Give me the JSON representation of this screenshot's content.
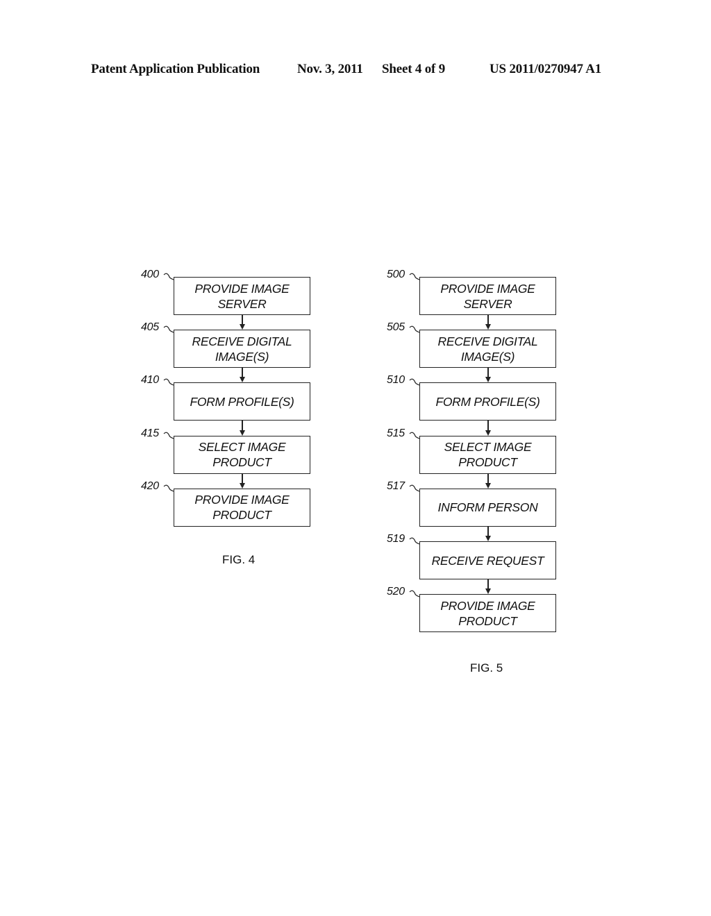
{
  "header": {
    "publication": "Patent Application Publication",
    "date": "Nov. 3, 2011",
    "sheet": "Sheet 4 of 9",
    "number": "US 2011/0270947 A1"
  },
  "fig4": {
    "caption": "FIG. 4",
    "steps": [
      {
        "ref": "400",
        "lines": [
          "PROVIDE IMAGE",
          "SERVER"
        ]
      },
      {
        "ref": "405",
        "lines": [
          "RECEIVE DIGITAL",
          "IMAGE(S)"
        ]
      },
      {
        "ref": "410",
        "lines": [
          "FORM PROFILE(S)"
        ]
      },
      {
        "ref": "415",
        "lines": [
          "SELECT IMAGE",
          "PRODUCT"
        ]
      },
      {
        "ref": "420",
        "lines": [
          "PROVIDE IMAGE",
          "PRODUCT"
        ]
      }
    ]
  },
  "fig5": {
    "caption": "FIG. 5",
    "steps": [
      {
        "ref": "500",
        "lines": [
          "PROVIDE IMAGE",
          "SERVER"
        ]
      },
      {
        "ref": "505",
        "lines": [
          "RECEIVE DIGITAL",
          "IMAGE(S)"
        ]
      },
      {
        "ref": "510",
        "lines": [
          "FORM PROFILE(S)"
        ]
      },
      {
        "ref": "515",
        "lines": [
          "SELECT IMAGE",
          "PRODUCT"
        ]
      },
      {
        "ref": "517",
        "lines": [
          "INFORM PERSON"
        ]
      },
      {
        "ref": "519",
        "lines": [
          "RECEIVE REQUEST"
        ]
      },
      {
        "ref": "520",
        "lines": [
          "PROVIDE IMAGE",
          "PRODUCT"
        ]
      }
    ]
  }
}
